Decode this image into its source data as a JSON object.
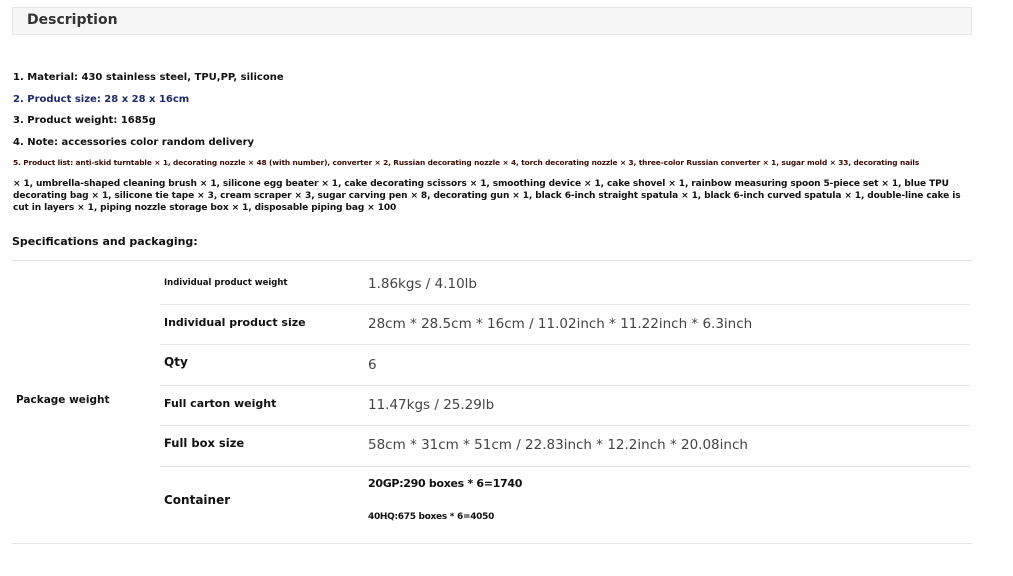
{
  "description": {
    "title": "Description",
    "material": "1. Material: 430 stainless steel, TPU,PP, silicone",
    "size": "2. Product size: 28 x 28 x 16cm",
    "weight": "3. Product weight: 1685g",
    "note": "4. Note: accessories color random delivery",
    "product_list_head": "5. Product list: anti-skid turntable × 1, decorating nozzle × 48 (with number), converter × 2, Russian decorating nozzle × 4, torch decorating nozzle × 3, three-color Russian converter × 1, sugar mold × 33, decorating nails",
    "product_list_body": "× 1, umbrella-shaped cleaning brush × 1, silicone egg beater × 1, cake decorating scissors × 1, smoothing device × 1, cake shovel × 1, rainbow measuring spoon 5-piece set × 1, blue TPU decorating bag × 1, silicone tie tape × 3, cream scraper × 3, sugar carving pen × 8, decorating gun × 1, black 6-inch straight spatula × 1, black 6-inch curved spatula × 1, double-line cake is cut in layers × 1, piping nozzle storage box × 1, disposable piping bag × 100"
  },
  "specs": {
    "title": "Specifications and packaging:",
    "group_label": "Package weight",
    "rows": [
      {
        "label": "Individual product weight",
        "value": "1.86kgs / 4.10lb"
      },
      {
        "label": "Individual product size",
        "value": "28cm * 28.5cm * 16cm / 11.02inch * 11.22inch * 6.3inch"
      },
      {
        "label": "Qty",
        "value": "6"
      },
      {
        "label": "Full carton weight",
        "value": "11.47kgs / 25.29lb"
      },
      {
        "label": "Full box size",
        "value": "58cm * 31cm * 51cm / 22.83inch * 12.2inch * 20.08inch"
      }
    ],
    "container": {
      "label": "Container",
      "line1": "20GP:290 boxes * 6=1740",
      "line2": "40HQ:675 boxes * 6=4050"
    }
  }
}
